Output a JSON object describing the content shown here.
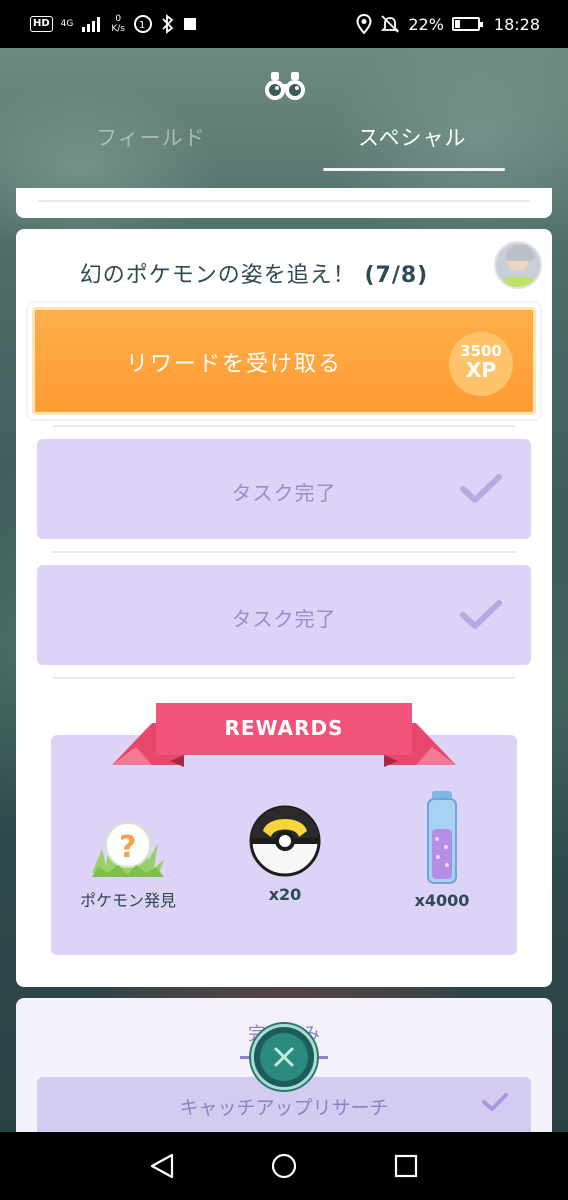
{
  "status_bar": {
    "hd": "HD",
    "network": "4G",
    "speed_value": "0",
    "speed_unit": "K/s",
    "battery_percent": "22%",
    "battery_level": 0.22,
    "time": "18:28"
  },
  "header": {
    "icon": "binoculars-icon",
    "tabs": [
      {
        "label": "フィールド",
        "selected": false
      },
      {
        "label": "スペシャル",
        "selected": true
      }
    ]
  },
  "quest": {
    "title": "幻のポケモンの姿を追え！",
    "progress": "(7/8)",
    "claim_button": "リワードを受け取る",
    "xp_amount": "3500",
    "xp_unit": "XP",
    "tasks": [
      {
        "label": "タスク完了",
        "icon": "check-icon"
      },
      {
        "label": "タスク完了",
        "icon": "check-icon"
      }
    ],
    "rewards_title": "REWARDS",
    "rewards": [
      {
        "icon": "pokemon-encounter-icon",
        "label": "ポケモン発見"
      },
      {
        "icon": "ultra-ball-icon",
        "label": "x20"
      },
      {
        "icon": "stardust-icon",
        "label": "x4000"
      }
    ]
  },
  "bottom": {
    "done_label": "完了済み",
    "catchup_label": "キャッチアップリサーチ"
  },
  "colors": {
    "orange": "#ff9a32",
    "lavender": "#dcd3f6",
    "ribbon": "#f0547a",
    "teal": "#2a8a7e"
  }
}
